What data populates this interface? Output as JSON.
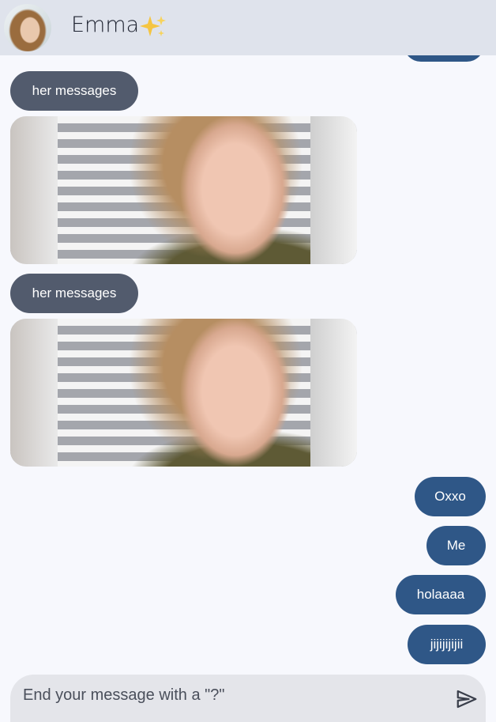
{
  "header": {
    "contact_name": "Emma",
    "avatar_icon": "profile-photo",
    "status_icon": "sparkles-icon"
  },
  "messages": [
    {
      "sender": "her",
      "type": "text",
      "text": "her messages"
    },
    {
      "sender": "her",
      "type": "gif"
    },
    {
      "sender": "her",
      "type": "text",
      "text": "her messages"
    },
    {
      "sender": "her",
      "type": "gif"
    },
    {
      "sender": "me",
      "type": "text",
      "text": "Oxxo"
    },
    {
      "sender": "me",
      "type": "text",
      "text": "Me"
    },
    {
      "sender": "me",
      "type": "text",
      "text": "holaaaa"
    },
    {
      "sender": "me",
      "type": "text",
      "text": "jijijijijii"
    }
  ],
  "composer": {
    "placeholder": "End your message with a \"?\"",
    "value": "",
    "send_icon": "send-icon"
  },
  "colors": {
    "header_bg": "#dfe3ec",
    "page_bg": "#f7f8fd",
    "her_bubble": "#525b6d",
    "my_bubble": "#2f5787",
    "composer_bg": "#e4e5ea"
  }
}
